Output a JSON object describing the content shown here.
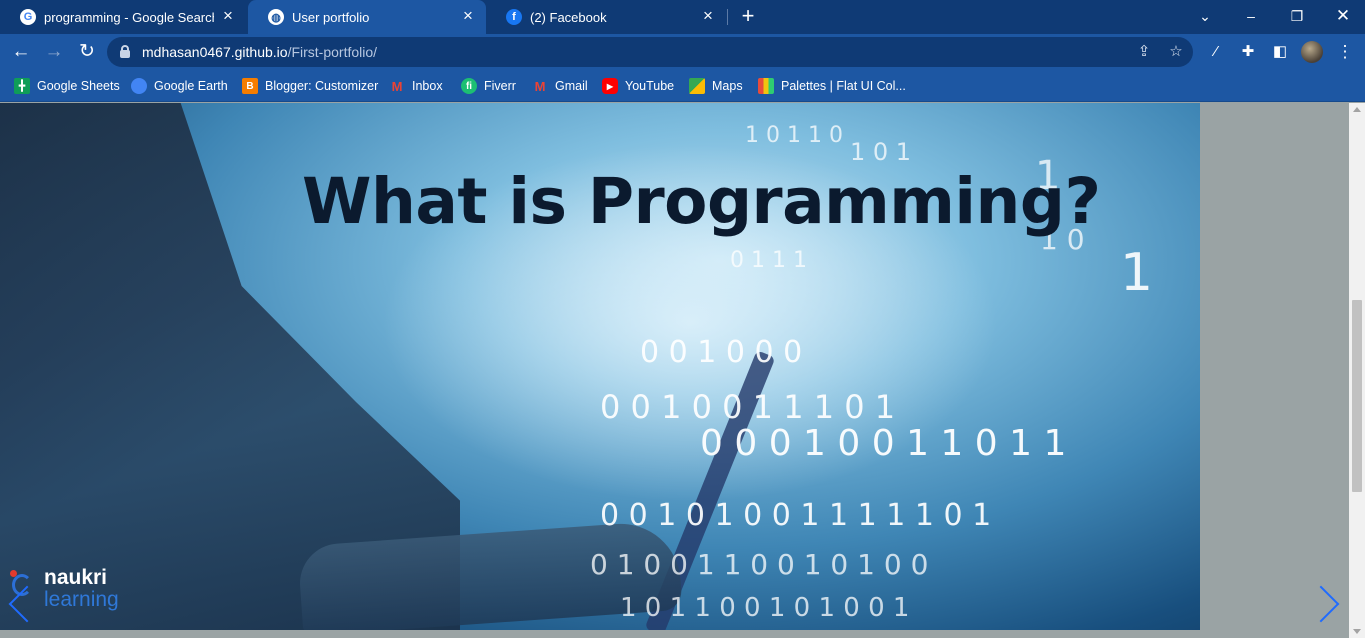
{
  "tabs": [
    {
      "title": "programming - Google Search",
      "favicon": "google-icon",
      "active": false
    },
    {
      "title": "User portfolio",
      "favicon": "globe-icon",
      "active": true
    },
    {
      "title": "(2) Facebook",
      "favicon": "facebook-icon",
      "active": false
    }
  ],
  "address_bar": {
    "host": "mdhasan0467.github.io",
    "path": "/First-portfolio/"
  },
  "bookmarks": [
    {
      "label": "Google Sheets",
      "icon": "sheets-icon",
      "color": "#0f9d58"
    },
    {
      "label": "Google Earth",
      "icon": "earth-icon",
      "color": "#4285f4"
    },
    {
      "label": "Blogger: Customizer",
      "icon": "blogger-icon",
      "color": "#f57d00"
    },
    {
      "label": "Inbox",
      "icon": "gmail-icon",
      "color": "#ea4335"
    },
    {
      "label": "Fiverr",
      "icon": "fiverr-icon",
      "color": "#1dbf73"
    },
    {
      "label": "Gmail",
      "icon": "gmail-icon",
      "color": "#ea4335"
    },
    {
      "label": "YouTube",
      "icon": "youtube-icon",
      "color": "#ff0000"
    },
    {
      "label": "Maps",
      "icon": "maps-icon",
      "color": "#34a853"
    },
    {
      "label": "Palettes | Flat UI Col...",
      "icon": "palettes-icon",
      "color": "#e74c3c"
    }
  ],
  "hero": {
    "title": "What is Programming?",
    "brand_line1": "naukri",
    "brand_line2": "learning"
  },
  "colors": {
    "tabstrip": "#0f3a75",
    "toolbar": "#1d57a3",
    "page_bg": "#9aa3a4",
    "arrow": "#1f6bff"
  }
}
